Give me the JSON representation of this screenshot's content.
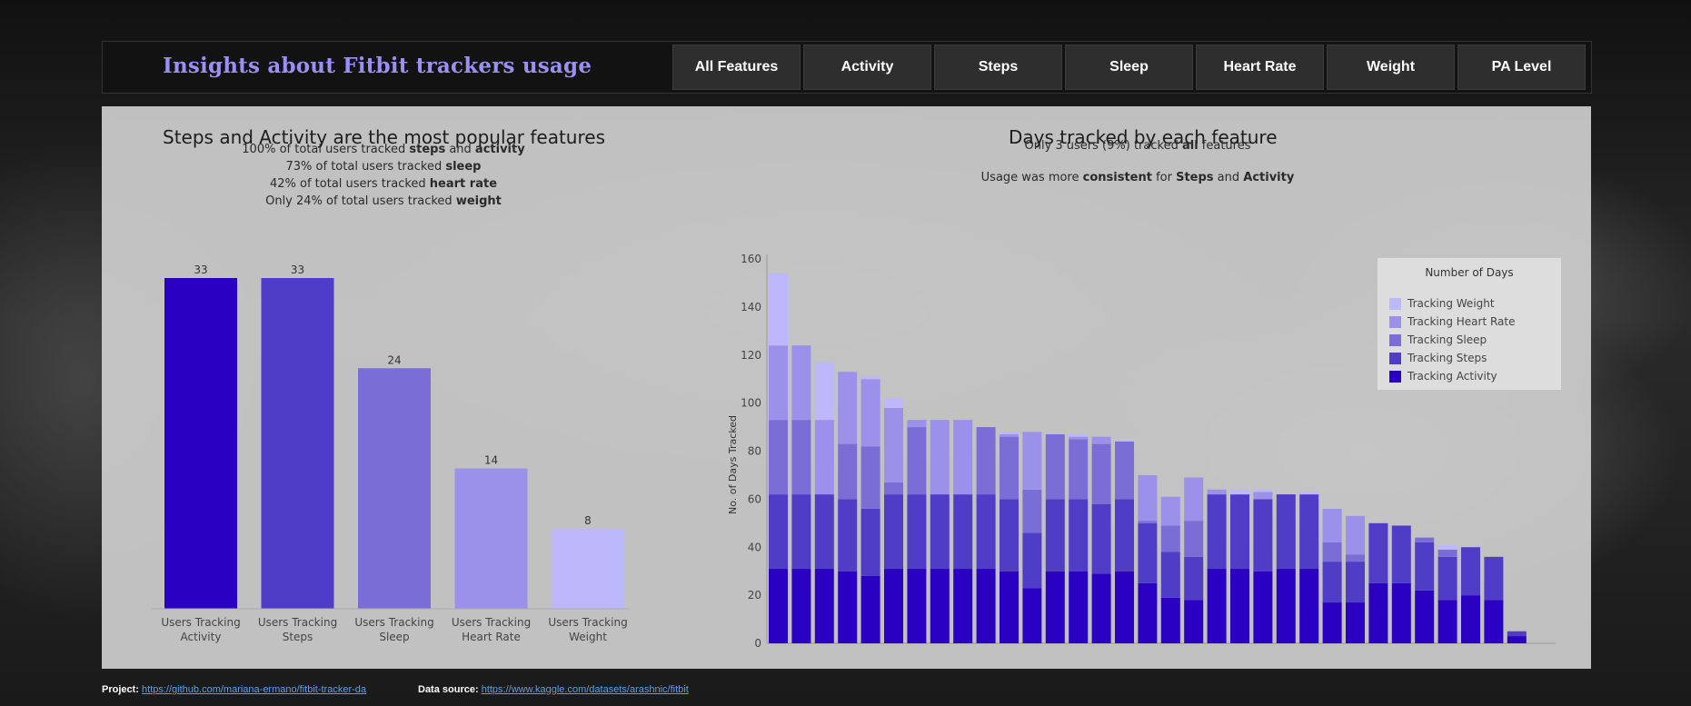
{
  "header": {
    "title": "Insights about Fitbit trackers usage",
    "tabs": [
      "All Features",
      "Activity",
      "Steps",
      "Sleep",
      "Heart Rate",
      "Weight",
      "PA Level"
    ]
  },
  "colors": {
    "activity": "#2a00c2",
    "steps": "#4f3dc8",
    "sleep": "#7a6ed6",
    "heart_rate": "#9b90ea",
    "weight": "#bdb7fb"
  },
  "left_chart": {
    "title": "Steps and Activity are the most popular features",
    "notes": [
      {
        "pre": "100% of total users tracked ",
        "b1": "steps",
        "mid": " and ",
        "b2": "activity"
      },
      {
        "pre": "73% of total users tracked ",
        "b1": "sleep",
        "mid": "",
        "b2": ""
      },
      {
        "pre": "42% of total users tracked ",
        "b1": "heart rate",
        "mid": "",
        "b2": ""
      },
      {
        "pre": "Only 24% of total users tracked ",
        "b1": "weight",
        "mid": "",
        "b2": ""
      }
    ]
  },
  "right_chart": {
    "title": "Days tracked by each feature",
    "note1_pre": "Only 3 users (9%) tracked ",
    "note1_b": "all",
    "note1_post": "  features",
    "note2_pre": "Usage was more ",
    "note2_b1": "consistent",
    "note2_mid": " for ",
    "note2_b2": "Steps",
    "note2_and": " and ",
    "note2_b3": "Activity"
  },
  "legend": {
    "title": "Number of Days",
    "items": [
      "Tracking Weight",
      "Tracking Heart Rate",
      "Tracking Sleep",
      "Tracking Steps",
      "Tracking Activity"
    ]
  },
  "chart_data": [
    {
      "type": "bar",
      "categories": [
        "Users Tracking Activity",
        "Users Tracking Steps",
        "Users Tracking Sleep",
        "Users Tracking Heart Rate",
        "Users Tracking Weight"
      ],
      "values": [
        33,
        33,
        24,
        14,
        8
      ],
      "ylim": [
        0,
        33
      ]
    },
    {
      "type": "bar",
      "stacked": true,
      "ylabel": "No. of Days Tracked",
      "ylim": [
        0,
        160
      ],
      "yticks": [
        0,
        20,
        40,
        60,
        80,
        100,
        120,
        140,
        160
      ],
      "legend_position": "top-right",
      "series": [
        {
          "name": "Tracking Activity",
          "values": [
            31,
            31,
            31,
            30,
            28,
            31,
            31,
            31,
            31,
            31,
            30,
            23,
            30,
            30,
            29,
            30,
            25,
            19,
            18,
            31,
            31,
            30,
            31,
            31,
            17,
            17,
            25,
            25,
            22,
            18,
            20,
            18,
            3
          ]
        },
        {
          "name": "Tracking Steps",
          "values": [
            31,
            31,
            31,
            30,
            28,
            31,
            31,
            31,
            31,
            31,
            30,
            23,
            30,
            30,
            29,
            30,
            25,
            19,
            18,
            31,
            31,
            30,
            31,
            31,
            17,
            17,
            25,
            24,
            20,
            18,
            20,
            18,
            2
          ]
        },
        {
          "name": "Tracking Sleep",
          "values": [
            31,
            31,
            0,
            23,
            26,
            5,
            28,
            0,
            0,
            28,
            26,
            18,
            27,
            25,
            25,
            24,
            1,
            11,
            15,
            0,
            0,
            0,
            0,
            0,
            8,
            3,
            0,
            0,
            2,
            3,
            0,
            0,
            0
          ]
        },
        {
          "name": "Tracking Heart Rate",
          "values": [
            31,
            31,
            31,
            30,
            28,
            31,
            3,
            31,
            31,
            0,
            1,
            24,
            0,
            1,
            3,
            0,
            19,
            12,
            18,
            2,
            0,
            3,
            0,
            0,
            14,
            16,
            0,
            0,
            0,
            0,
            0,
            0,
            0
          ]
        },
        {
          "name": "Tracking Weight",
          "values": [
            30,
            0,
            24,
            0,
            1,
            4,
            0,
            0,
            0,
            0,
            1,
            0,
            0,
            1,
            0,
            0,
            0,
            0,
            0,
            0,
            2,
            1,
            0,
            1,
            0,
            0,
            0,
            0,
            0,
            2,
            0,
            0,
            0
          ]
        }
      ]
    }
  ],
  "footer": {
    "project_label": "Project:",
    "project_link": "https://github.com/mariana-ermano/fitbit-tracker-da",
    "source_label": "Data source:",
    "source_link": "https://www.kaggle.com/datasets/arashnic/fitbit"
  }
}
